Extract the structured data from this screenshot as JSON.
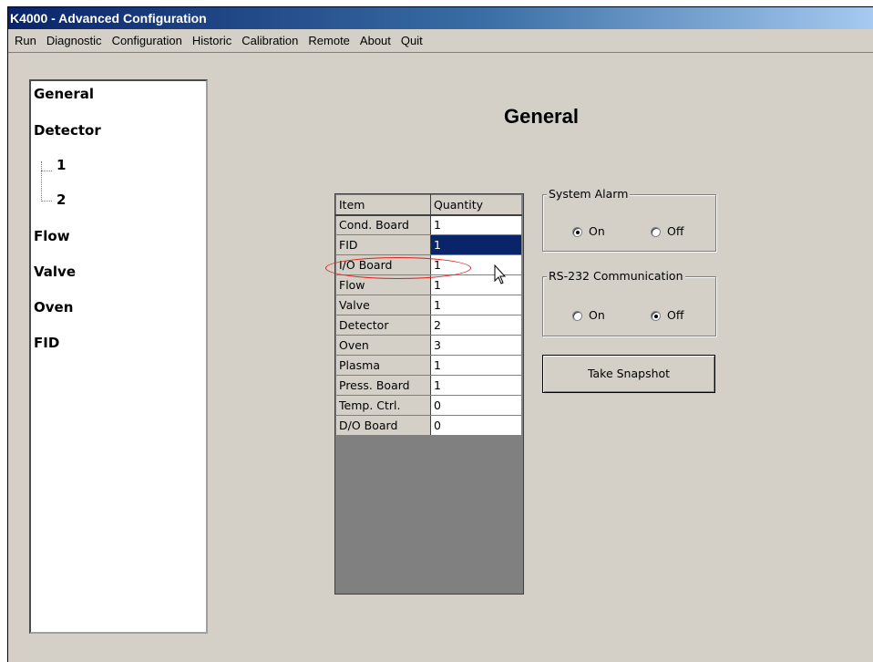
{
  "window": {
    "title": "K4000 - Advanced Configuration"
  },
  "menu": [
    "Run",
    "Diagnostic",
    "Configuration",
    "Historic",
    "Calibration",
    "Remote",
    "About",
    "Quit"
  ],
  "nav": {
    "general": "General",
    "detector": "Detector",
    "detector_1": "1",
    "detector_2": "2",
    "flow": "Flow",
    "valve": "Valve",
    "oven": "Oven",
    "fid": "FID"
  },
  "page": {
    "title": "General"
  },
  "grid": {
    "headers": [
      "Item",
      "Quantity"
    ],
    "rows": [
      {
        "item": "Cond. Board",
        "quantity": "1"
      },
      {
        "item": "FID",
        "quantity": "1"
      },
      {
        "item": "I/O Board",
        "quantity": "1"
      },
      {
        "item": "Flow",
        "quantity": "1"
      },
      {
        "item": "Valve",
        "quantity": "1"
      },
      {
        "item": "Detector",
        "quantity": "2"
      },
      {
        "item": "Oven",
        "quantity": "3"
      },
      {
        "item": "Plasma",
        "quantity": "1"
      },
      {
        "item": "Press. Board",
        "quantity": "1"
      },
      {
        "item": "Temp. Ctrl.",
        "quantity": "0"
      },
      {
        "item": "D/O Board",
        "quantity": "0"
      }
    ],
    "selected_row": "FID"
  },
  "system_alarm": {
    "label": "System Alarm",
    "on": "On",
    "off": "Off",
    "selected": "On"
  },
  "rs232": {
    "label": "RS-232 Communication",
    "on": "On",
    "off": "Off",
    "selected": "Off"
  },
  "snapshot_button": "Take Snapshot",
  "icons": {
    "cursor": "mouse-pointer-icon"
  },
  "colors": {
    "title_gradient_start": "#0a246a",
    "selection": "#0a246a",
    "highlight_circle": "#e02020",
    "face": "#d4d0c8"
  }
}
